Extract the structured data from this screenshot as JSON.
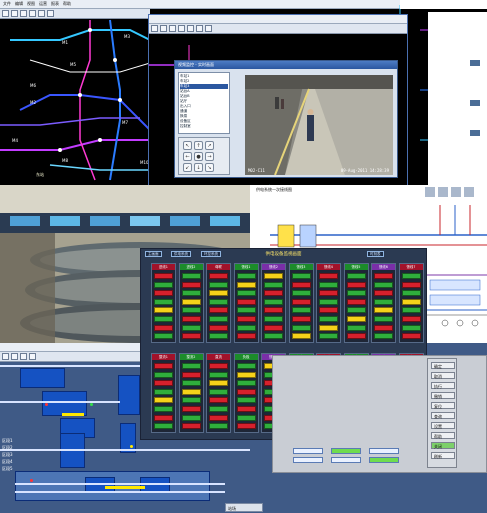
{
  "metro": {
    "menu": [
      "文件",
      "编辑",
      "视图",
      "运营",
      "报表",
      "帮助"
    ],
    "line_labels": [
      "M1",
      "M2",
      "M3",
      "M4",
      "M5",
      "M6",
      "M7",
      "M8",
      "M10"
    ],
    "station_labels": [
      "北站",
      "东站",
      "火车站",
      "广场",
      "南站",
      "东门"
    ]
  },
  "cctv": {
    "window_title": "视频监控 - 实时画面",
    "tree_items": [
      "车站1",
      "车站2",
      "车站3",
      "站台A",
      "站台B",
      "站厅",
      "出入口",
      "通道",
      "换乘",
      "设备区",
      "控制室"
    ],
    "ptz_buttons": [
      "↖",
      "↑",
      "↗",
      "←",
      "●",
      "→",
      "↙",
      "↓",
      "↘"
    ],
    "camera_label": "M02-C11",
    "timestamp": "09-Aug-2011 14:28:39"
  },
  "scada": {
    "title": "供电设备监视画面",
    "tabs": [
      "主画面",
      "供电系统",
      "环控系统",
      "时刻表"
    ],
    "units_row1": [
      "进线1",
      "进线2",
      "母联",
      "馈线1",
      "馈线2",
      "馈线3",
      "馈线4",
      "馈线5",
      "馈线6",
      "馈线7"
    ],
    "units_row2": [
      "整流1",
      "整流2",
      "直流",
      "负极",
      "馈出1",
      "馈出2",
      "馈出3",
      "馈出4",
      "馈出5",
      "馈出6"
    ],
    "colors": {
      "closed": "#d6202c",
      "open": "#2fae3c",
      "alarm": "#f5d21a",
      "header_a": "#a2122a",
      "header_b": "#1c8c2a",
      "header_c": "#7a2fa8"
    }
  },
  "track": {
    "side_labels": [
      "区段1",
      "区段2",
      "区段3",
      "区段4",
      "区段5"
    ],
    "bottom_tab": "站场"
  },
  "dialog": {
    "buttons": [
      "确定",
      "取消",
      "执行",
      "撤销",
      "复位",
      "查询",
      "设置",
      "帮助",
      "关闭",
      "刷新"
    ]
  },
  "schematic": {
    "header": "供电系统一次接线图"
  }
}
